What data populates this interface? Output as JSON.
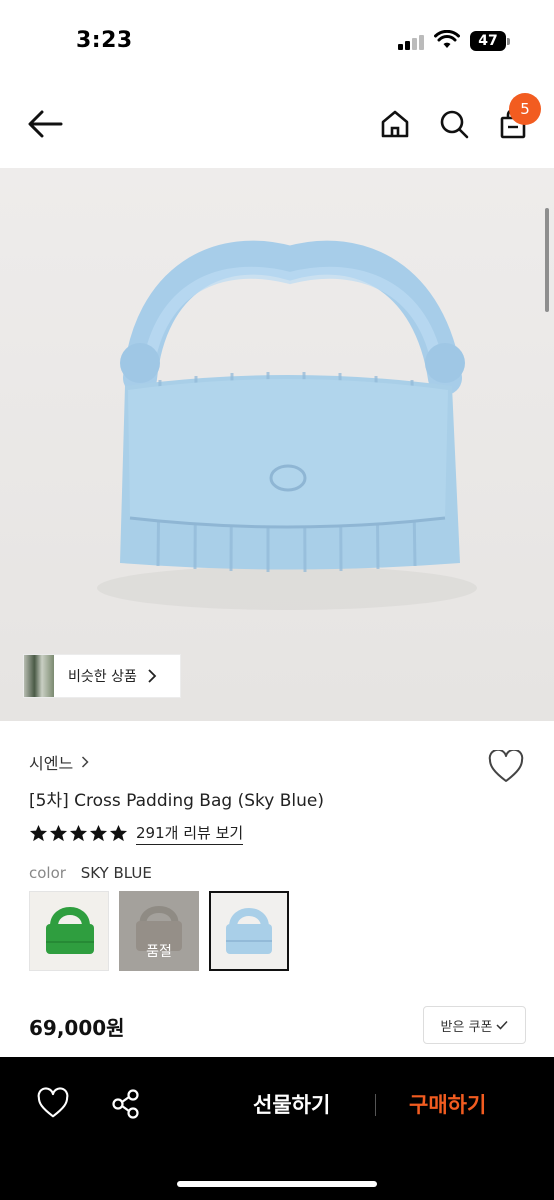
{
  "status": {
    "time": "3:23",
    "battery": "47"
  },
  "header": {
    "cart_count": "5",
    "icons": [
      "back-arrow-icon",
      "home-icon",
      "search-icon",
      "shopping-bag-icon"
    ]
  },
  "product_image": {
    "similar_products_label": "비슷한 상품"
  },
  "product": {
    "brand": "시엔느",
    "title": "[5차] Cross Padding Bag (Sky Blue)",
    "rating_stars": 5,
    "reviews_label": "291개 리뷰 보기",
    "color_label": "color",
    "color_value": "SKY BLUE",
    "swatches": [
      {
        "color": "green",
        "hex": "#2f9e3f",
        "status": ""
      },
      {
        "color": "gray",
        "hex": "#a4a19c",
        "status": "품절"
      },
      {
        "color": "sky blue",
        "hex": "#a9cfe8",
        "status": "",
        "selected": true
      }
    ],
    "price": "69,000원",
    "coupon_label": "받은 쿠폰"
  },
  "bottom_bar": {
    "gift_label": "선물하기",
    "buy_label": "구매하기",
    "accent": "#f25c20"
  }
}
